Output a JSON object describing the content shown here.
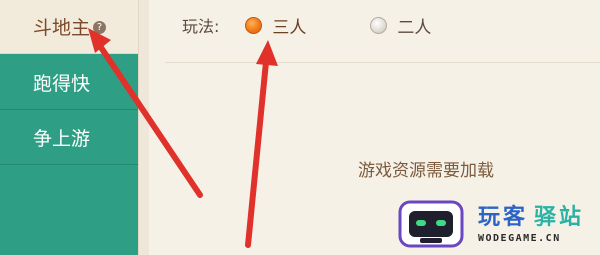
{
  "sidebar": {
    "items": [
      {
        "label": "斗地主",
        "active": true,
        "help": "?"
      },
      {
        "label": "跑得快",
        "active": false
      },
      {
        "label": "争上游",
        "active": false
      }
    ]
  },
  "mode": {
    "label": "玩法:",
    "options": [
      {
        "label": "三人",
        "selected": true
      },
      {
        "label": "二人",
        "selected": false
      }
    ]
  },
  "status": {
    "loading_text": "游戏资源需要加载"
  },
  "watermark": {
    "brand_a": "玩客",
    "brand_b": "驿站",
    "domain": "WODEGAME.CN"
  },
  "colors": {
    "sidebar_bg": "#2e9f84",
    "active_tab_bg": "#f2eadb",
    "content_bg": "#f6f1e7",
    "radio_selected": "#f07a17",
    "arrow": "#e0312b"
  }
}
